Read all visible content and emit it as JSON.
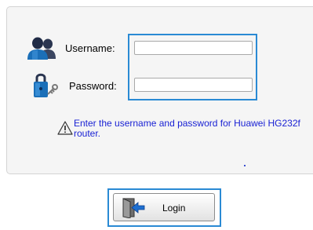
{
  "form": {
    "username_label": "Username:",
    "password_label": "Password:",
    "username_value": "",
    "password_value": "",
    "username_placeholder": "",
    "password_placeholder": "",
    "hint": "Enter the username and password for Huawei HG232f router."
  },
  "login": {
    "label": "Login"
  },
  "icons": {
    "user": "user-icon",
    "password": "lock-icon",
    "warning": "warning-icon",
    "login": "door-icon"
  },
  "colors": {
    "focus": "#2a8ad4",
    "hint_text": "#1a22d4"
  }
}
